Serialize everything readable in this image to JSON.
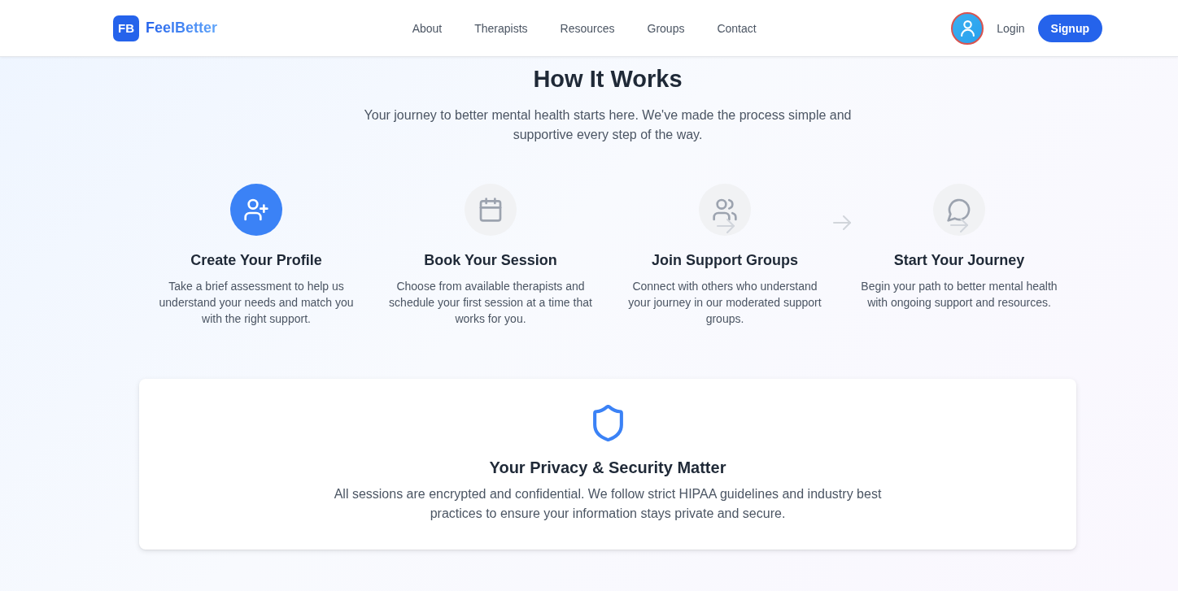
{
  "nav": {
    "logo_mark": "FB",
    "brand": "FeelBetter",
    "links": [
      {
        "label": "About"
      },
      {
        "label": "Therapists"
      },
      {
        "label": "Resources"
      },
      {
        "label": "Groups"
      },
      {
        "label": "Contact"
      }
    ],
    "login": "Login",
    "signup": "Signup"
  },
  "intro": {
    "title": "How It Works",
    "subtitle": "Your journey to better mental health starts here. We've made the process simple and supportive every step of the way."
  },
  "steps": [
    {
      "title": "Create Your Profile",
      "description": "Take a brief assessment to help us understand your needs and match you with the right support.",
      "selected": true
    },
    {
      "title": "Book Your Session",
      "description": "Choose from available therapists and schedule your first session at a time that works for you.",
      "selected": false
    },
    {
      "title": "Join Support Groups",
      "description": "Connect with others who understand your journey in our moderated support groups.",
      "selected": false
    },
    {
      "title": "Start Your Journey",
      "description": "Begin your path to better mental health with ongoing support and resources.",
      "selected": false
    }
  ],
  "privacy": {
    "title": "Your Privacy & Security Matter",
    "text": "All sessions are encrypted and confidential. We follow strict HIPAA guidelines and industry best practices to ensure your information stays private and secure."
  }
}
